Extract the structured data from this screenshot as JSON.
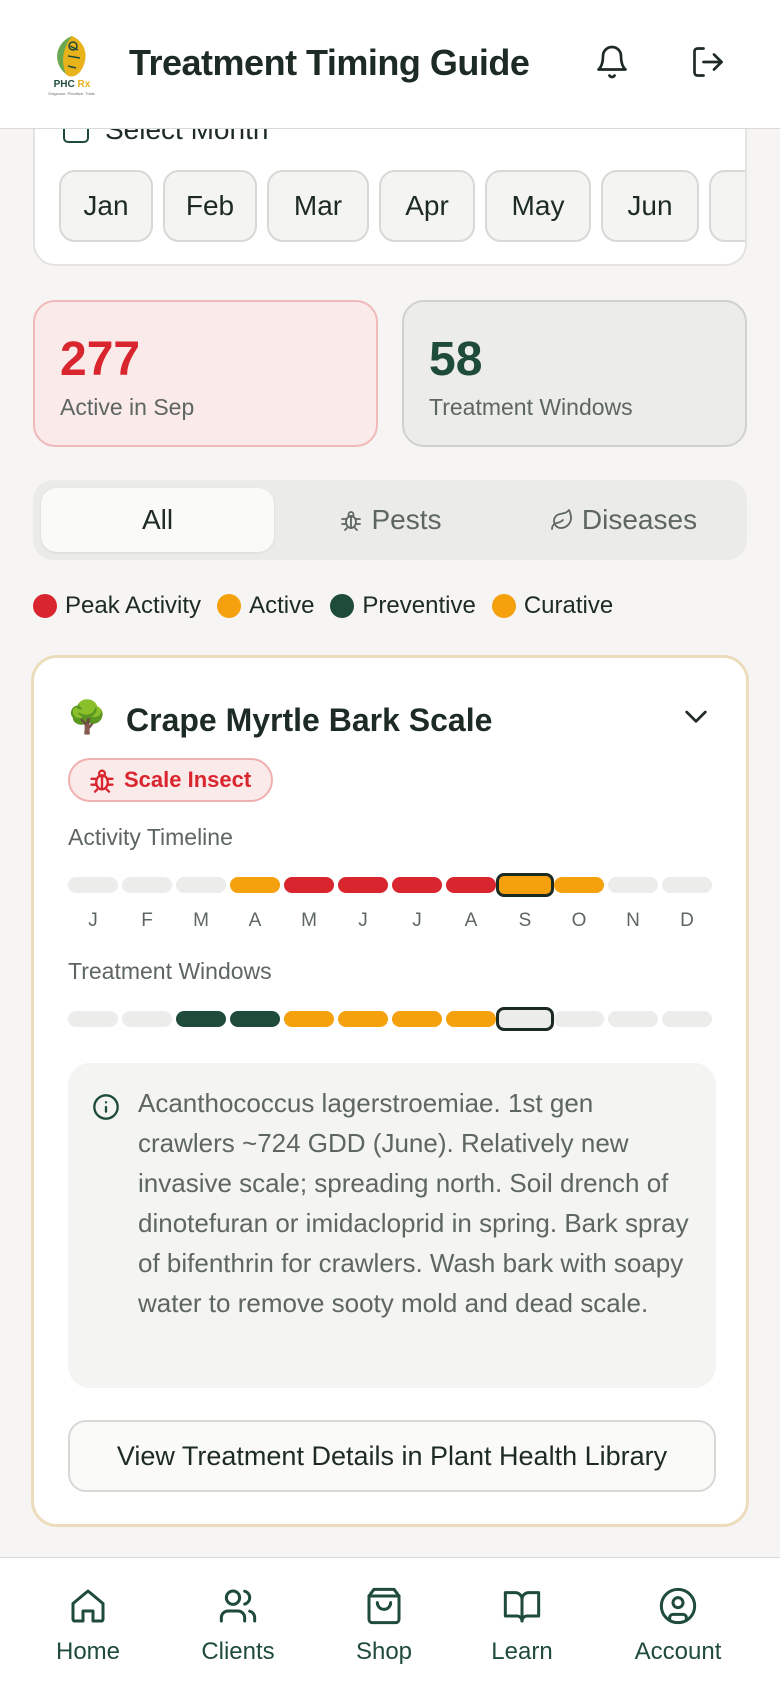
{
  "header": {
    "title": "Treatment Timing Guide",
    "logo_text": "PHC Rx",
    "logo_tagline": "Diagnose. Prioritize. Treat."
  },
  "month_selector": {
    "label": "Select Month",
    "months": [
      "Jan",
      "Feb",
      "Mar",
      "Apr",
      "May",
      "Jun"
    ]
  },
  "stats": {
    "active_count": "277",
    "active_label": "Active in Sep",
    "windows_count": "58",
    "windows_label": "Treatment Windows"
  },
  "tabs": {
    "all": "All",
    "pests": "Pests",
    "diseases": "Diseases"
  },
  "legend": [
    {
      "label": "Peak Activity",
      "color": "#d9262e"
    },
    {
      "label": "Active",
      "color": "#f5a00d"
    },
    {
      "label": "Preventive",
      "color": "#1f4b3a"
    },
    {
      "label": "Curative",
      "color": "#f5a00d"
    }
  ],
  "pest": {
    "name": "Crape Myrtle Bark Scale",
    "icon": "tree-icon",
    "badge": "Scale Insect",
    "activity_label": "Activity Timeline",
    "activity": [
      "none",
      "none",
      "none",
      "active",
      "peak",
      "peak",
      "peak",
      "peak",
      "active",
      "active",
      "none",
      "none"
    ],
    "month_letters": [
      "J",
      "F",
      "M",
      "A",
      "M",
      "J",
      "J",
      "A",
      "S",
      "O",
      "N",
      "D"
    ],
    "windows_label": "Treatment Windows",
    "windows": [
      "none",
      "none",
      "preventive",
      "preventive",
      "curative",
      "curative",
      "curative",
      "curative",
      "none",
      "none",
      "none",
      "none"
    ],
    "current_month_index": 8,
    "description": "Acanthococcus lagerstroemiae. 1st gen crawlers ~724 GDD (June). Relatively new invasive scale; spreading north. Soil drench of dinotefuran or imidacloprid in spring. Bark spray of bifenthrin for crawlers. Wash bark with soapy water to remove sooty mold and dead scale.",
    "details_button": "View Treatment Details in Plant Health Library"
  },
  "colors": {
    "peak": "#d9262e",
    "active": "#f5a00d",
    "preventive": "#1f4b3a",
    "curative": "#f5a00d",
    "none": "#ececea"
  },
  "nav": {
    "home": "Home",
    "clients": "Clients",
    "shop": "Shop",
    "learn": "Learn",
    "account": "Account"
  }
}
